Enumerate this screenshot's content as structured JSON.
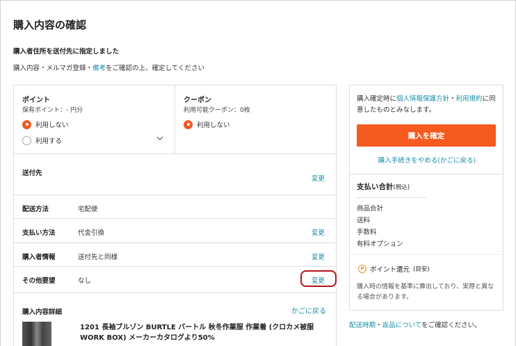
{
  "page": {
    "title": "購入内容の確認",
    "notice": "購入者住所を送付先に指定しました",
    "subnotice_prefix": "購入内容・メルマガ登録・",
    "subnotice_link": "備考",
    "subnotice_suffix": "をご確認の上、確定してください"
  },
  "point": {
    "title": "ポイント",
    "balance": "保有ポイント：- 円分",
    "options": [
      "利用しない",
      "利用する"
    ],
    "selected": "利用しない"
  },
  "coupon": {
    "title": "クーポン",
    "available": "利用可能クーポン：0枚",
    "options": [
      "利用しない"
    ],
    "selected": "利用しない"
  },
  "rows": {
    "shipping_to": {
      "label": "送付先",
      "value": "",
      "change": "変更"
    },
    "delivery": {
      "label": "配送方法",
      "value": "宅配便"
    },
    "payment": {
      "label": "支払い方法",
      "value": "代金引換",
      "change": "変更"
    },
    "buyer": {
      "label": "購入者情報",
      "value": "送付先と同様",
      "change": "変更"
    },
    "other": {
      "label": "その他要望",
      "value": "なし",
      "change": "変更"
    }
  },
  "detail": {
    "title": "購入内容詳細",
    "back_link": "かごに戻る",
    "item_name": "1201 長袖ブルゾン BURTLE バートル 秋冬作業服 作業着 (クロカメ被服 WORK BOX) メーカーカタログより50%"
  },
  "summary": {
    "confirm_prefix": "購入確定時に",
    "privacy_link": "個人情報保護方針",
    "dot": "・",
    "terms_link": "利用規約",
    "confirm_suffix": "に同意したものとみなします。",
    "buy_button": "購入を確定",
    "cancel_link": "購入手続きをやめる(かごに戻る)",
    "total_title": "支払い合計",
    "total_tax": "(税込)",
    "items": [
      "商品合計",
      "送料",
      "手数料",
      "有料オプション"
    ],
    "point_icon": "P",
    "point_label": "ポイント還元",
    "point_label_small": "(目安)",
    "point_note": "購入時の情報を基準に算出しており、実際と異なる場合があります。"
  },
  "footer": {
    "link1": "配送時期",
    "dot": "・",
    "link2": "返品について",
    "suffix": "をご確認ください。"
  },
  "colors": {
    "accent": "#f55a1e",
    "link": "#1a8fa6",
    "highlight": "#b3121b"
  }
}
